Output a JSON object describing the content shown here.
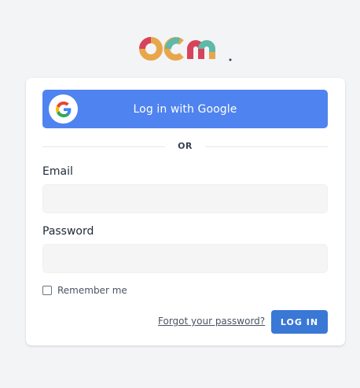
{
  "brand": {
    "logo_text": "ocm",
    "colors": [
      "#e8a64a",
      "#d7435b",
      "#5fb8a8",
      "#4f83ef"
    ]
  },
  "login": {
    "google_button_label": "Log in with Google",
    "divider_text": "OR",
    "email_label": "Email",
    "email_value": "",
    "password_label": "Password",
    "password_value": "",
    "remember_label": "Remember me",
    "remember_checked": false,
    "forgot_link": "Forgot your password?",
    "submit_label": "LOG IN"
  },
  "icons": {
    "google": "google-g-icon"
  },
  "theme": {
    "google_button": "#4f83ef",
    "primary_button": "#3a78d6",
    "background": "#f3f4f6"
  }
}
